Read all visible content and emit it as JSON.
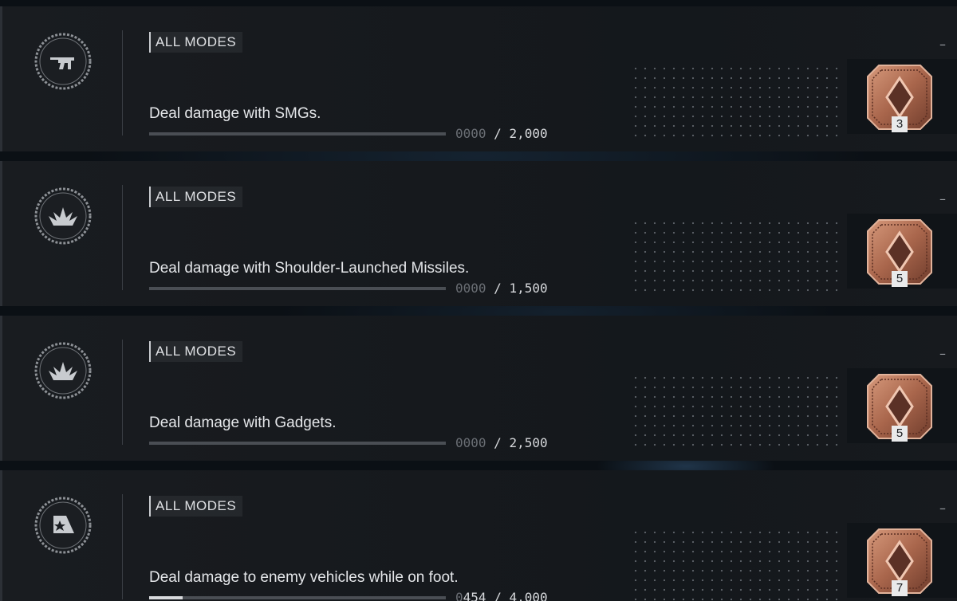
{
  "challenges": [
    {
      "mode": "ALL MODES",
      "description": "Deal damage with SMGs.",
      "progress_current_dim": "0000",
      "progress_current_bright": "",
      "progress_sep": "/",
      "progress_total": "2,000",
      "progress_fraction": 0.0,
      "reward_count": "3",
      "menu_dash": "–",
      "icon": "smg-icon"
    },
    {
      "mode": "ALL MODES",
      "description": "Deal damage with Shoulder-Launched Missiles.",
      "progress_current_dim": "0000",
      "progress_current_bright": "",
      "progress_sep": "/",
      "progress_total": "1,500",
      "progress_fraction": 0.0,
      "reward_count": "5",
      "menu_dash": "–",
      "icon": "explosion-icon"
    },
    {
      "mode": "ALL MODES",
      "description": "Deal damage with Gadgets.",
      "progress_current_dim": "0000",
      "progress_current_bright": "",
      "progress_sep": "/",
      "progress_total": "2,500",
      "progress_fraction": 0.0,
      "reward_count": "5",
      "menu_dash": "–",
      "icon": "explosion-icon"
    },
    {
      "mode": "ALL MODES",
      "description": "Deal damage to enemy vehicles while on foot.",
      "progress_current_dim": "0",
      "progress_current_bright": "454",
      "progress_sep": "/",
      "progress_total": "4,000",
      "progress_fraction": 0.1135,
      "reward_count": "7",
      "menu_dash": "–",
      "icon": "vehicle-flag-icon"
    }
  ],
  "colors": {
    "medal_bronze": "#b9785e",
    "medal_bronze_dark": "#7a4634",
    "text_primary": "#e4e6e9",
    "bar_track": "#4a4e54",
    "bar_fill": "#d8dadd"
  }
}
